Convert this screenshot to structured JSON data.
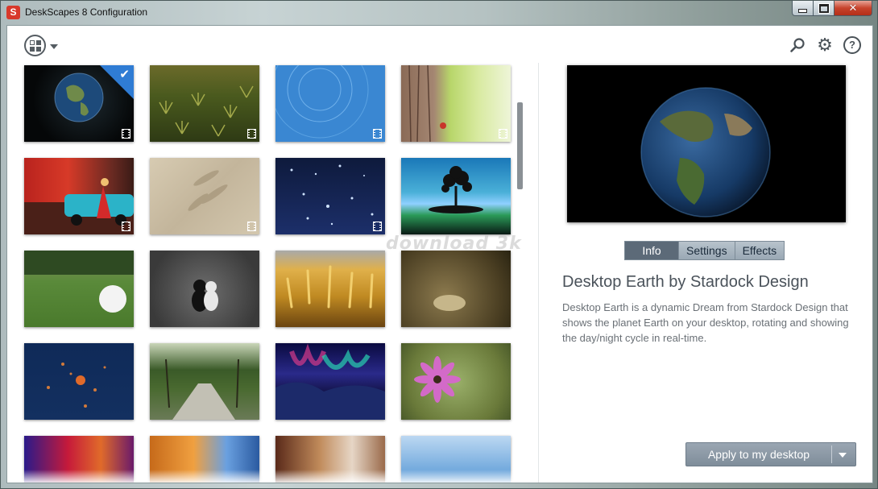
{
  "window": {
    "title": "DeskScapes 8 Configuration"
  },
  "toolbar": {
    "layout_icon": "grid-layout-icon",
    "search_icon": "search-icon",
    "settings_icon": "gear-icon",
    "help_icon": "help-icon",
    "help_glyph": "?"
  },
  "watermark": "download 3k",
  "thumbnails": [
    {
      "name": "Desktop Earth",
      "selected": true,
      "video": true
    },
    {
      "name": "Pine Grass",
      "video": true
    },
    {
      "name": "Blue Circles",
      "video": true
    },
    {
      "name": "Tree Bark",
      "video": true
    },
    {
      "name": "Retro Car",
      "video": true
    },
    {
      "name": "Sand",
      "video": true
    },
    {
      "name": "Night Stars",
      "video": true
    },
    {
      "name": "Floating Tree",
      "video": false
    },
    {
      "name": "Golf Ball",
      "video": false
    },
    {
      "name": "Cats",
      "video": false
    },
    {
      "name": "Wheat Field",
      "video": false
    },
    {
      "name": "Dry Grass",
      "video": false
    },
    {
      "name": "Planets",
      "video": false
    },
    {
      "name": "Tree Lane",
      "video": false
    },
    {
      "name": "Aurora",
      "video": false
    },
    {
      "name": "Pink Flower",
      "video": false
    },
    {
      "name": "Spectrum",
      "video": false
    },
    {
      "name": "Sunburst",
      "video": false
    },
    {
      "name": "Abstract Curves",
      "video": false
    },
    {
      "name": "Blue Swirl",
      "video": false
    }
  ],
  "tabs": [
    "Info",
    "Settings",
    "Effects"
  ],
  "active_tab": "Info",
  "details": {
    "title": "Desktop Earth by Stardock Design",
    "description": "Desktop Earth is a dynamic Dream from Stardock Design that shows the planet Earth on your desktop, rotating and showing the day/night cycle in real-time."
  },
  "apply_button": {
    "label": "Apply to my desktop"
  }
}
